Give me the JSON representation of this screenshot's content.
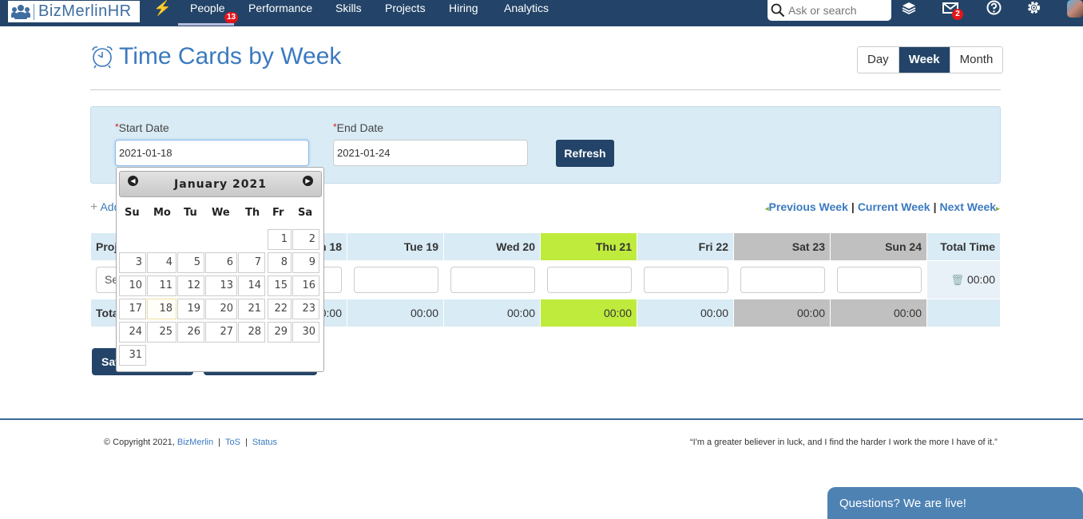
{
  "topnav": {
    "logo_text": "BizMerlinHR",
    "items": [
      {
        "label": "People",
        "badge": "13",
        "active": true
      },
      {
        "label": "Performance"
      },
      {
        "label": "Skills"
      },
      {
        "label": "Projects"
      },
      {
        "label": "Hiring"
      },
      {
        "label": "Analytics"
      }
    ],
    "search_placeholder": "Ask or search",
    "mail_badge": "2"
  },
  "page": {
    "title": "Time Cards by Week",
    "view_toggle": [
      "Day",
      "Week",
      "Month"
    ],
    "view_selected": "Week"
  },
  "filters": {
    "start_label": "Start Date",
    "start_value": "2021-01-18",
    "end_label": "End Date",
    "end_value": "2021-01-24",
    "refresh_label": "Refresh"
  },
  "actions": {
    "add_label": "Add",
    "previous_week": "Previous Week",
    "current_week": "Current Week",
    "next_week": "Next Week",
    "save_label": "Save",
    "second_button_label": ""
  },
  "table": {
    "project_header": "Project",
    "project_select": "Select",
    "total_row_label": "Total",
    "total_header": "Total Time",
    "row_total": "00:00",
    "days": [
      {
        "label": "Mon 18",
        "total": "00:00",
        "type": "weekday"
      },
      {
        "label": "Tue 19",
        "total": "00:00",
        "type": "weekday"
      },
      {
        "label": "Wed 20",
        "total": "00:00",
        "type": "weekday"
      },
      {
        "label": "Thu 21",
        "total": "00:00",
        "type": "today"
      },
      {
        "label": "Fri 22",
        "total": "00:00",
        "type": "weekday"
      },
      {
        "label": "Sat 23",
        "total": "00:00",
        "type": "weekend"
      },
      {
        "label": "Sun 24",
        "total": "00:00",
        "type": "weekend"
      }
    ],
    "colors": {
      "today": "#bfeb3d",
      "weekend": "#c0c0c0",
      "header": "#d9ebf5"
    }
  },
  "datepicker": {
    "month_label": "January 2021",
    "weekdays": [
      "Su",
      "Mo",
      "Tu",
      "We",
      "Th",
      "Fr",
      "Sa"
    ],
    "first_weekday_index": 5,
    "days_in_month": 31,
    "highlighted_day": 18
  },
  "footer": {
    "copyright": "© Copyright 2021,",
    "brand_link": "BizMerlin",
    "tos": "ToS",
    "status": "Status",
    "quote": "“I'm a greater believer in luck, and I find the harder I work the more I have of it.”"
  },
  "chat": {
    "label": "Questions? We are live!"
  }
}
